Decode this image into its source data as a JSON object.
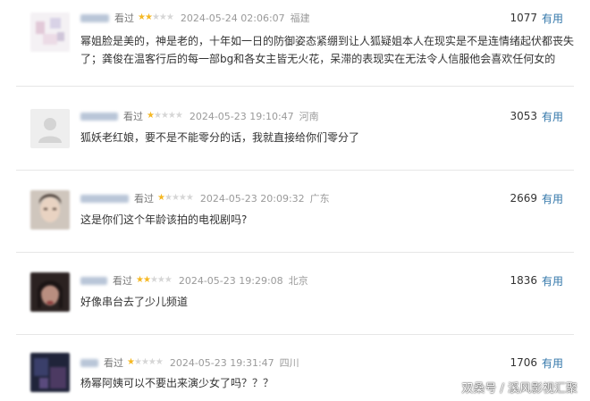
{
  "useful_label": "有用",
  "comments": [
    {
      "user": "用户",
      "status": "看过",
      "stars": 2,
      "time": "2024-05-24 02:06:07",
      "location": "福建",
      "count": "1077",
      "lines": [
        "幂姐脸是美的，神是老的，十年如一日的防御姿态紧绷到让人狐疑姐本人在现实是不是连情绪起伏都丧失",
        "了；龚俊在温客行后的每一部bg和各女主皆无火花，呆滞的表现实在无法令人信服他会喜欢任何女的"
      ]
    },
    {
      "user": "用户",
      "status": "看过",
      "stars": 1,
      "time": "2024-05-23 19:10:47",
      "location": "河南",
      "count": "3053",
      "lines": [
        "狐妖老红娘，要不是不能零分的话，我就直接给你们零分了"
      ]
    },
    {
      "user": "用户",
      "status": "看过",
      "stars": 1,
      "time": "2024-05-23 20:09:32",
      "location": "广东",
      "count": "2669",
      "lines": [
        "这是你们这个年龄该拍的电视剧吗?"
      ]
    },
    {
      "user": "用户",
      "status": "看过",
      "stars": 2,
      "time": "2024-05-23 19:29:08",
      "location": "北京",
      "count": "1836",
      "lines": [
        "好像串台去了少儿频道"
      ]
    },
    {
      "user": "用户",
      "status": "看过",
      "stars": 1,
      "time": "2024-05-23 19:31:47",
      "location": "四川",
      "count": "1706",
      "lines": [
        "杨幂阿姨可以不要出来演少女了吗？？？"
      ]
    }
  ],
  "watermark": "双桑号 / 溪风影视汇聚",
  "colors": {
    "star_on": "#f5b824",
    "star_off": "#d6d6d6",
    "useful_link": "#3377aa"
  }
}
